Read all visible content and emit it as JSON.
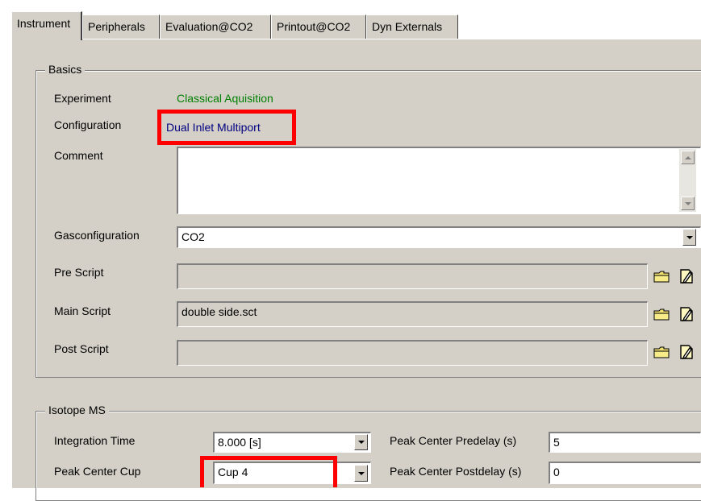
{
  "tabs": [
    {
      "label": "Instrument",
      "active": true
    },
    {
      "label": "Peripherals",
      "active": false
    },
    {
      "label": "Evaluation@CO2",
      "active": false
    },
    {
      "label": "Printout@CO2",
      "active": false
    },
    {
      "label": "Dyn Externals",
      "active": false
    }
  ],
  "basics": {
    "title": "Basics",
    "experiment_label": "Experiment",
    "experiment_value": "Classical Aquisition",
    "experiment_color": "#008000",
    "configuration_label": "Configuration",
    "configuration_value": "Dual Inlet Multiport",
    "configuration_color": "#000080",
    "comment_label": "Comment",
    "comment_value": "",
    "gasconfig_label": "Gasconfiguration",
    "gasconfig_value": "CO2",
    "pre_script_label": "Pre Script",
    "pre_script_value": "",
    "main_script_label": "Main Script",
    "main_script_value": "double side.sct",
    "post_script_label": "Post Script",
    "post_script_value": ""
  },
  "isotope_ms": {
    "title": "Isotope MS",
    "integration_time_label": "Integration Time",
    "integration_time_value": "8.000 [s]",
    "peak_center_cup_label": "Peak Center Cup",
    "peak_center_cup_value": "Cup 4",
    "peak_center_predelay_label": "Peak Center Predelay (s)",
    "peak_center_predelay_value": "5",
    "peak_center_postdelay_label": "Peak Center Postdelay (s)",
    "peak_center_postdelay_value": "0"
  },
  "icons": {
    "folder": "folder-icon",
    "edit": "edit-script-icon"
  },
  "highlight_color": "#ff0000"
}
